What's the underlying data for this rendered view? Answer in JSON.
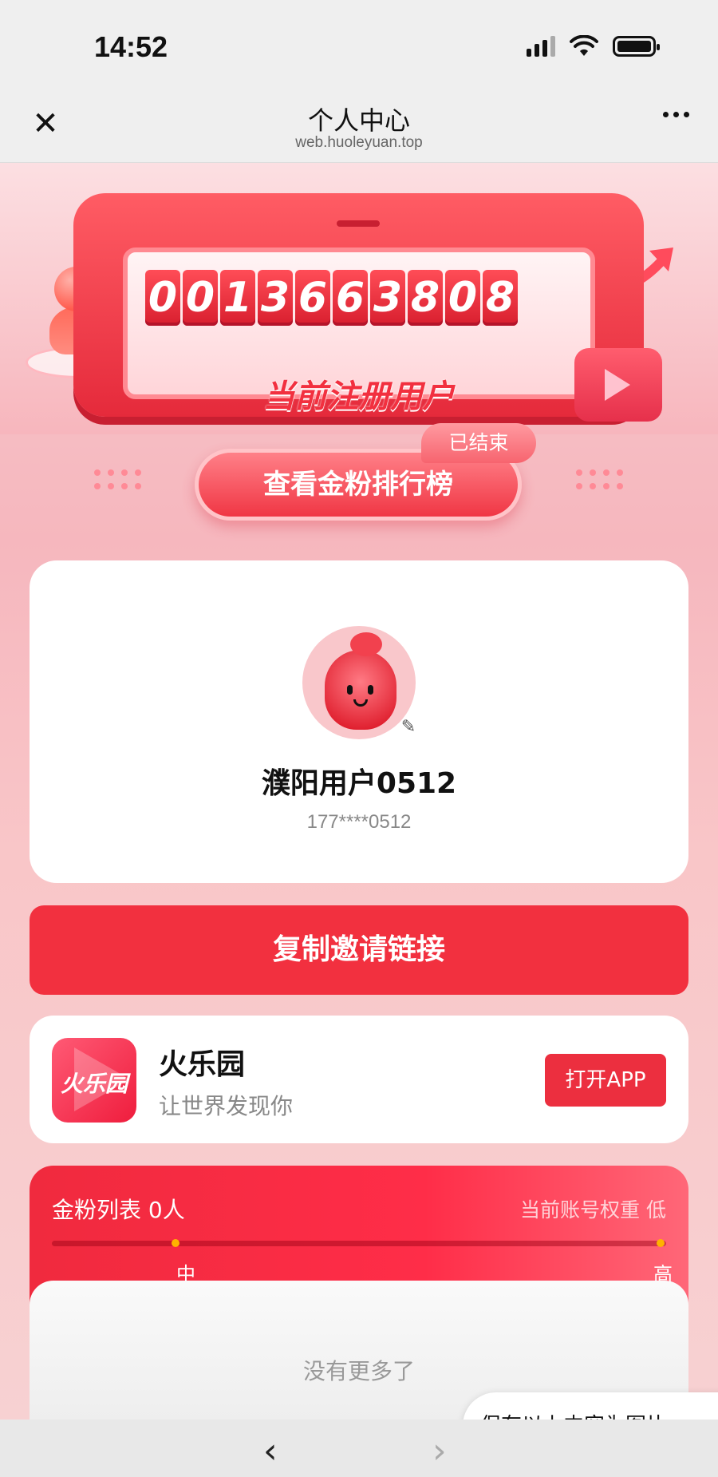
{
  "status_bar": {
    "time": "14:52"
  },
  "nav": {
    "title": "个人中心",
    "url": "web.huoleyuan.top",
    "close_icon": "close-icon",
    "more_icon": "more-dots-icon"
  },
  "hero": {
    "digits": [
      "0",
      "0",
      "1",
      "3",
      "6",
      "6",
      "3",
      "8",
      "0",
      "8"
    ],
    "label": "当前注册用户"
  },
  "ranking": {
    "button_label": "查看金粉排行榜",
    "badge": "已结束"
  },
  "profile": {
    "nickname": "濮阳用户0512",
    "phone": "177****0512",
    "edit_icon": "pencil-icon"
  },
  "invite": {
    "button_label": "复制邀请链接"
  },
  "app_card": {
    "logo_text": "火乐园",
    "name": "火乐园",
    "slogan": "让世界发现你",
    "open_button": "打开APP"
  },
  "fans": {
    "title": "金粉列表 0人",
    "weight_label": "当前账号权重 低",
    "levels": [
      "中",
      "高"
    ],
    "empty_text": "没有更多了"
  },
  "save_button": {
    "label": "保存以上内容为图片"
  },
  "colors": {
    "accent": "#f2303f",
    "progress": "#ffb300"
  }
}
